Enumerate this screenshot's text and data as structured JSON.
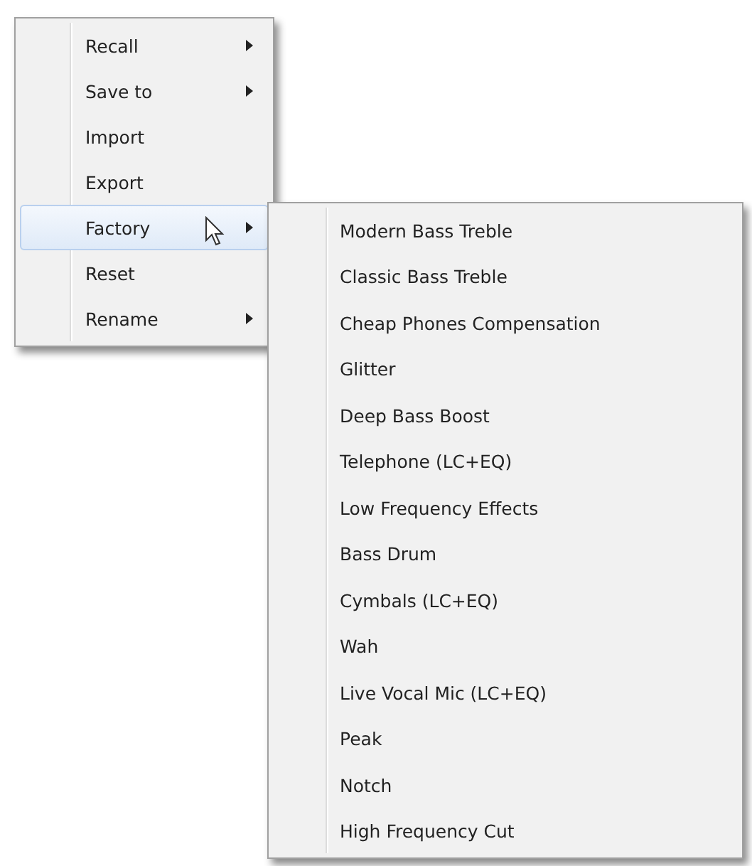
{
  "context_menu": {
    "items": [
      {
        "label": "Recall",
        "has_submenu": true,
        "selected": false
      },
      {
        "label": "Save to",
        "has_submenu": true,
        "selected": false
      },
      {
        "label": "Import",
        "has_submenu": false,
        "selected": false
      },
      {
        "label": "Export",
        "has_submenu": false,
        "selected": false
      },
      {
        "label": "Factory",
        "has_submenu": true,
        "selected": true
      },
      {
        "label": "Reset",
        "has_submenu": false,
        "selected": false
      },
      {
        "label": "Rename",
        "has_submenu": true,
        "selected": false
      }
    ]
  },
  "submenu": {
    "items": [
      {
        "label": "Modern Bass Treble"
      },
      {
        "label": "Classic Bass Treble"
      },
      {
        "label": "Cheap Phones Compensation"
      },
      {
        "label": "Glitter"
      },
      {
        "label": "Deep Bass Boost"
      },
      {
        "label": "Telephone (LC+EQ)"
      },
      {
        "label": "Low Frequency Effects"
      },
      {
        "label": "Bass Drum"
      },
      {
        "label": "Cymbals (LC+EQ)"
      },
      {
        "label": "Wah"
      },
      {
        "label": "Live Vocal Mic (LC+EQ)"
      },
      {
        "label": "Peak"
      },
      {
        "label": "Notch"
      },
      {
        "label": "High Frequency Cut"
      }
    ]
  }
}
